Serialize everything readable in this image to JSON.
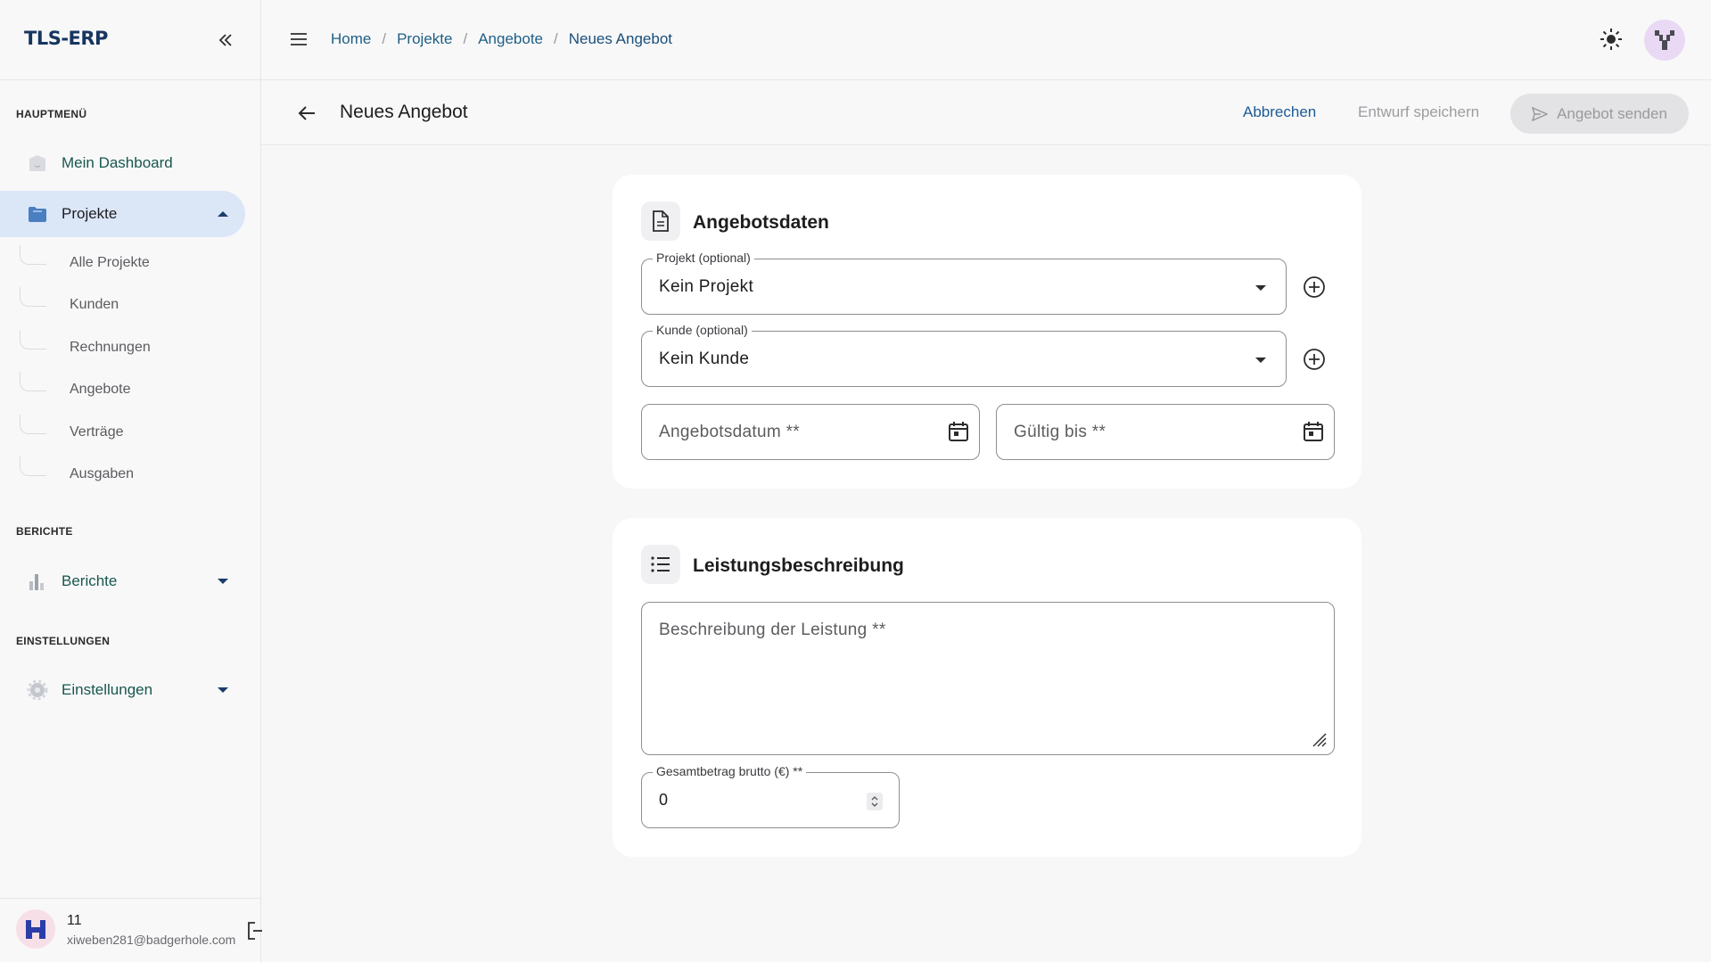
{
  "app": {
    "logo": "TLS-ERP"
  },
  "sidebar": {
    "sections": {
      "main": "HAUPTMENÜ",
      "reports": "BERICHTE",
      "settings": "EINSTELLUNGEN"
    },
    "items": {
      "dashboard": "Mein Dashboard",
      "projects": "Projekte",
      "reports": "Berichte",
      "settings": "Einstellungen"
    },
    "subitems": [
      "Alle Projekte",
      "Kunden",
      "Rechnungen",
      "Angebote",
      "Verträge",
      "Ausgaben"
    ],
    "user": {
      "name": "11",
      "email": "xiweben281@badgerhole.com"
    }
  },
  "breadcrumb": [
    "Home",
    "Projekte",
    "Angebote",
    "Neues Angebot"
  ],
  "page": {
    "title": "Neues Angebot",
    "actions": {
      "cancel": "Abbrechen",
      "draft": "Entwurf speichern",
      "send": "Angebot senden"
    }
  },
  "offer_data": {
    "title": "Angebotsdaten",
    "project": {
      "label": "Projekt (optional)",
      "value": "Kein Projekt"
    },
    "customer": {
      "label": "Kunde (optional)",
      "value": "Kein Kunde"
    },
    "offer_date": {
      "placeholder": "Angebotsdatum **"
    },
    "valid_until": {
      "placeholder": "Gültig bis **"
    }
  },
  "service": {
    "title": "Leistungsbeschreibung",
    "description": {
      "placeholder": "Beschreibung der Leistung **"
    },
    "total": {
      "label": "Gesamtbetrag brutto (€) **",
      "value": "0"
    }
  },
  "colors": {
    "accent": "#1d5a95",
    "active_bg": "#dbe6f7",
    "nav_text": "#18574e"
  }
}
